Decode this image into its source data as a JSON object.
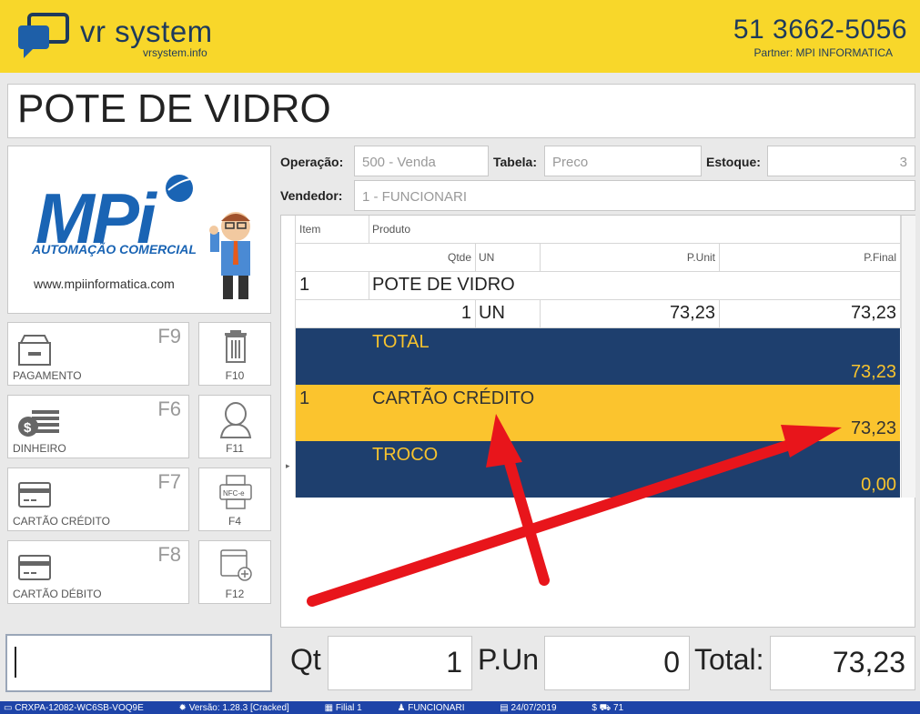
{
  "header": {
    "brand": "vr system",
    "brand_url": "vrsystem.info",
    "phone": "51 3662-5056",
    "partner": "Partner: MPI INFORMATICA"
  },
  "product_title": "POTE DE VIDRO",
  "logo": {
    "name": "MPi",
    "tagline": "AUTOMAÇÃO COMERCIAL",
    "url": "www.mpiinformatica.com"
  },
  "actions": [
    {
      "key": "F9",
      "label": "PAGAMENTO",
      "icon": "cash-drawer-icon"
    },
    {
      "key": "F6",
      "label": "DINHEIRO",
      "icon": "coins-icon"
    },
    {
      "key": "F7",
      "label": "CARTÃO CRÉDITO",
      "icon": "credit-card-icon"
    },
    {
      "key": "F8",
      "label": "CARTÃO DÉBITO",
      "icon": "debit-card-icon"
    }
  ],
  "side_actions": [
    {
      "label": "F10",
      "icon": "trash-icon"
    },
    {
      "label": "F11",
      "icon": "user-icon"
    },
    {
      "label": "F4",
      "icon": "nfce-printer-icon"
    },
    {
      "label": "F12",
      "icon": "window-add-icon"
    }
  ],
  "fields": {
    "operacao_label": "Operação:",
    "operacao_value": "500 - Venda",
    "tabela_label": "Tabela:",
    "tabela_value": "Preco",
    "estoque_label": "Estoque:",
    "estoque_value": "3",
    "vendedor_label": "Vendedor:",
    "vendedor_value": "1 - FUNCIONARI"
  },
  "grid": {
    "headers": {
      "item": "Item",
      "produto": "Produto",
      "qtde": "Qtde",
      "un": "UN",
      "punit": "P.Unit",
      "pfinal": "P.Final"
    },
    "row": {
      "item": "1",
      "produto": "POTE DE VIDRO",
      "qtde": "1",
      "un": "UN",
      "punit": "73,23",
      "pfinal": "73,23"
    },
    "total": {
      "label": "TOTAL",
      "value": "73,23"
    },
    "payment": {
      "item": "1",
      "label": "CARTÃO CRÉDITO",
      "value": "73,23"
    },
    "troco": {
      "label": "TROCO",
      "value": "0,00"
    }
  },
  "bottom": {
    "qt_label": "Qt",
    "qt_value": "1",
    "pun_label": "P.Un",
    "pun_value": "0",
    "total_label": "Total:",
    "total_value": "73,23"
  },
  "status": {
    "serial": "CRXPA-12082-WC6SB-VOQ9E",
    "version": "Versão: 1.28.3 [Cracked]",
    "filial": "Filial 1",
    "user": "FUNCIONARI",
    "date": "24/07/2019",
    "cart": "71"
  },
  "colors": {
    "header_bg": "#f8d72a",
    "band_blue": "#1e3f6e",
    "band_yellow": "#fbc42e",
    "band_text": "#f7c32e",
    "status_bar": "#1e44a8",
    "arrow": "#e8151b"
  }
}
